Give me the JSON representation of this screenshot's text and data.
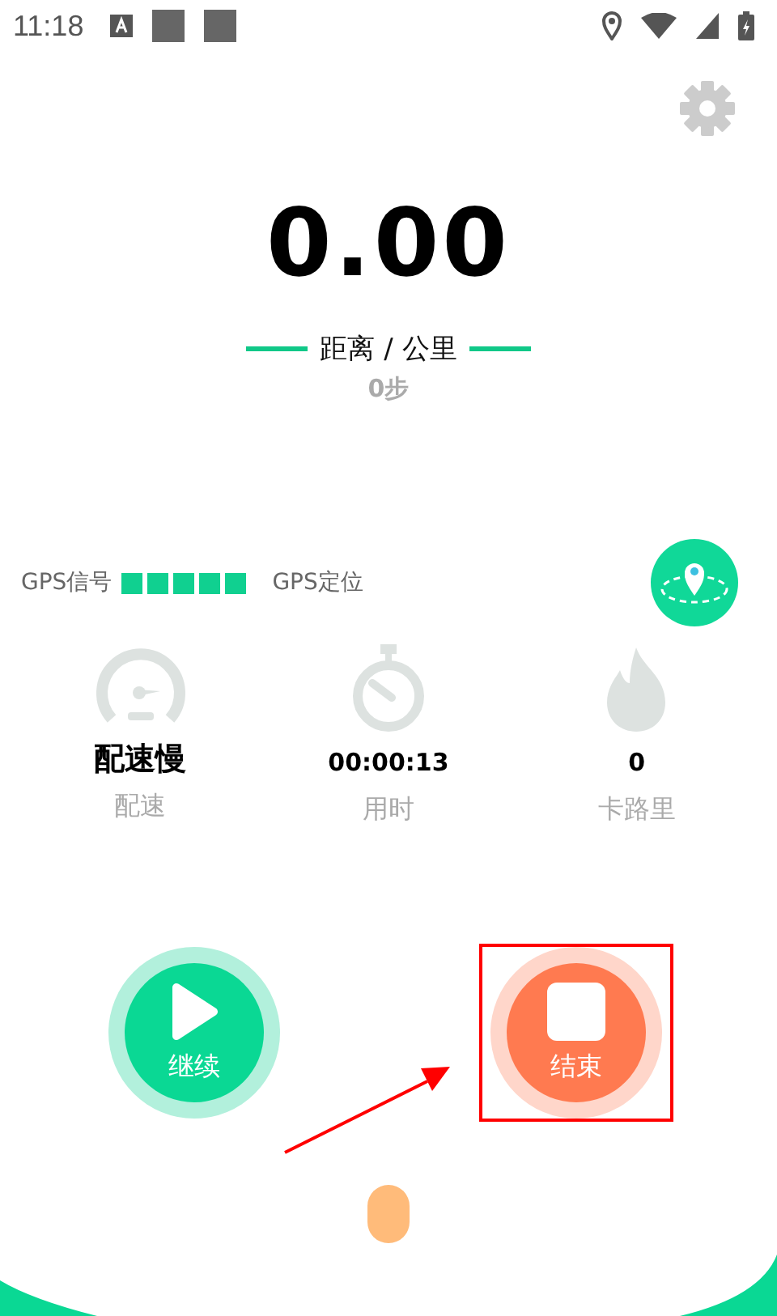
{
  "status_bar": {
    "time": "11:18"
  },
  "distance": {
    "value": "0.00",
    "label": "距离 / 公里",
    "steps": "0步"
  },
  "gps": {
    "signal_label": "GPS信号",
    "bars": [
      {
        "on": true
      },
      {
        "on": true
      },
      {
        "on": true
      },
      {
        "on": true
      },
      {
        "on": true
      }
    ],
    "locate_label": "GPS定位"
  },
  "stats": [
    {
      "kind": "pace",
      "value": "配速慢",
      "label": "配速"
    },
    {
      "kind": "time",
      "value": "00:00:13",
      "label": "用时"
    },
    {
      "kind": "calories",
      "value": "0",
      "label": "卡路里"
    }
  ],
  "buttons": [
    {
      "kind": "resume",
      "label": "继续",
      "highlighted": false
    },
    {
      "kind": "stop",
      "label": "结束",
      "highlighted": true
    }
  ]
}
